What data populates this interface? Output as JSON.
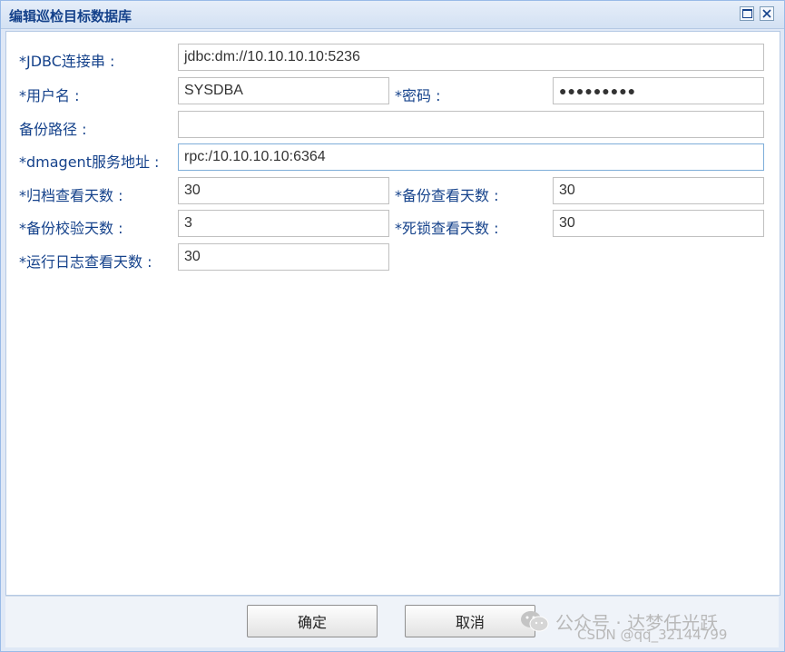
{
  "window": {
    "title": "编辑巡检目标数据库",
    "maximize_icon": "maximize-icon",
    "close_icon": "close-icon"
  },
  "form": {
    "jdbc": {
      "label": "*JDBC连接串 :",
      "value": "jdbc:dm://10.10.10.10:5236"
    },
    "username": {
      "label": "*用户名 :",
      "value": "SYSDBA"
    },
    "password": {
      "label": "*密码 :",
      "value": "●●●●●●●●●"
    },
    "backup_path": {
      "label": "备份路径 :",
      "value": ""
    },
    "dmagent": {
      "label": "*dmagent服务地址 :",
      "value": "rpc:/10.10.10.10:6364"
    },
    "archive_days": {
      "label": "*归档查看天数 :",
      "value": "30"
    },
    "backup_view_days": {
      "label": "*备份查看天数 :",
      "value": "30"
    },
    "backup_verify_days": {
      "label": "*备份校验天数 :",
      "value": "3"
    },
    "deadlock_days": {
      "label": "*死锁查看天数 :",
      "value": "30"
    },
    "runlog_days": {
      "label": "*运行日志查看天数 :",
      "value": "30"
    }
  },
  "footer": {
    "ok_label": "确定",
    "cancel_label": "取消"
  },
  "watermark": {
    "line1": "公众号 · 达梦任光跃",
    "line2": "CSDN @qq_32144799"
  },
  "colors": {
    "label": "#15428b",
    "title_bar": "#d3e1f3",
    "border": "#99bbe8",
    "focus_border": "#7eadd9"
  }
}
